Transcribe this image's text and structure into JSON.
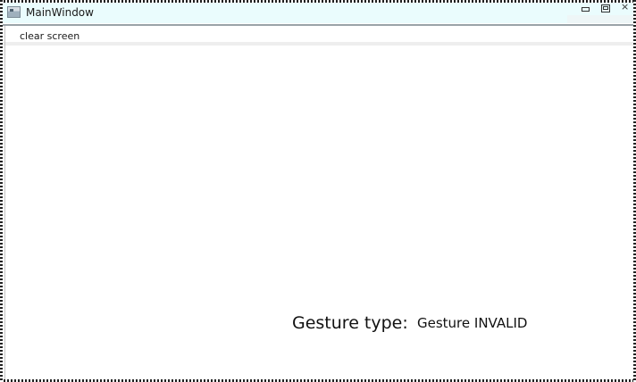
{
  "window": {
    "title": "MainWindow",
    "close_glyph": "×"
  },
  "toolbar": {
    "clear_label": "clear screen"
  },
  "gesture": {
    "label": "Gesture type:",
    "value": "Gesture INVALID"
  },
  "icons": {
    "app": "app-window-icon",
    "minimize": "minimize-icon",
    "maximize": "restore-icon",
    "close": "close-icon"
  },
  "colors": {
    "titlebar_bg": "#eafcfd",
    "canvas_bg": "#ffffff",
    "text": "#111111"
  }
}
